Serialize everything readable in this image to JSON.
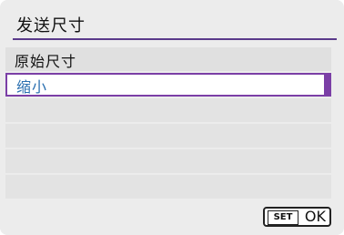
{
  "screen": {
    "title": "发送尺寸",
    "menu_items": [
      {
        "label": "原始尺寸",
        "selected": false
      },
      {
        "label": "缩小",
        "selected": true
      }
    ],
    "footer": {
      "set_label": "SET",
      "ok_label": "OK"
    },
    "colors": {
      "accent": "#7b3fa6",
      "selected_text": "#2a6fb0",
      "background": "#ececec"
    }
  }
}
